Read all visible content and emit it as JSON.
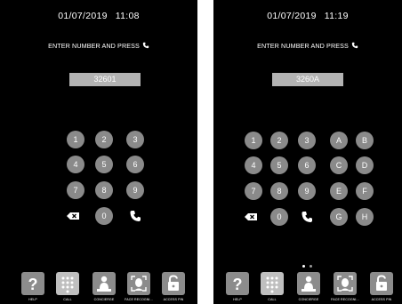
{
  "left": {
    "date": "01/07/2019",
    "time": "11:08",
    "instruction": "ENTER NUMBER AND PRESS",
    "entered_number": "32601",
    "keys": [
      "1",
      "2",
      "3",
      "4",
      "5",
      "6",
      "7",
      "8",
      "9",
      "0"
    ],
    "dock": [
      {
        "label": "HELP",
        "icon": "help-icon"
      },
      {
        "label": "CALL",
        "icon": "keypad-icon"
      },
      {
        "label": "CONCIERGE",
        "icon": "concierge-icon"
      },
      {
        "label": "FACE RECOGNI...",
        "icon": "face-recognition-icon"
      },
      {
        "label": "ACCESS PIN",
        "icon": "lock-icon"
      }
    ]
  },
  "right": {
    "date": "01/07/2019",
    "time": "11:19",
    "instruction": "ENTER NUMBER AND PRESS",
    "entered_number": "3260A",
    "keys": [
      "1",
      "2",
      "3",
      "4",
      "5",
      "6",
      "7",
      "8",
      "9",
      "0"
    ],
    "letters": [
      "A",
      "B",
      "C",
      "D",
      "E",
      "F",
      "G",
      "H"
    ],
    "dock": [
      {
        "label": "HELP",
        "icon": "help-icon"
      },
      {
        "label": "CALL",
        "icon": "keypad-icon"
      },
      {
        "label": "CONCIERGE",
        "icon": "concierge-icon"
      },
      {
        "label": "FACE RECOGNI...",
        "icon": "face-recognition-icon"
      },
      {
        "label": "ACCESS PIN",
        "icon": "lock-icon"
      }
    ],
    "page_indicator": {
      "count": 2,
      "active": 1
    }
  },
  "colors": {
    "background": "#000000",
    "key": "#8a8a8a",
    "display": "#b3b3b3",
    "dock_active": "#bfbfbf",
    "dock": "#8c8c8c",
    "text": "#ffffff"
  }
}
